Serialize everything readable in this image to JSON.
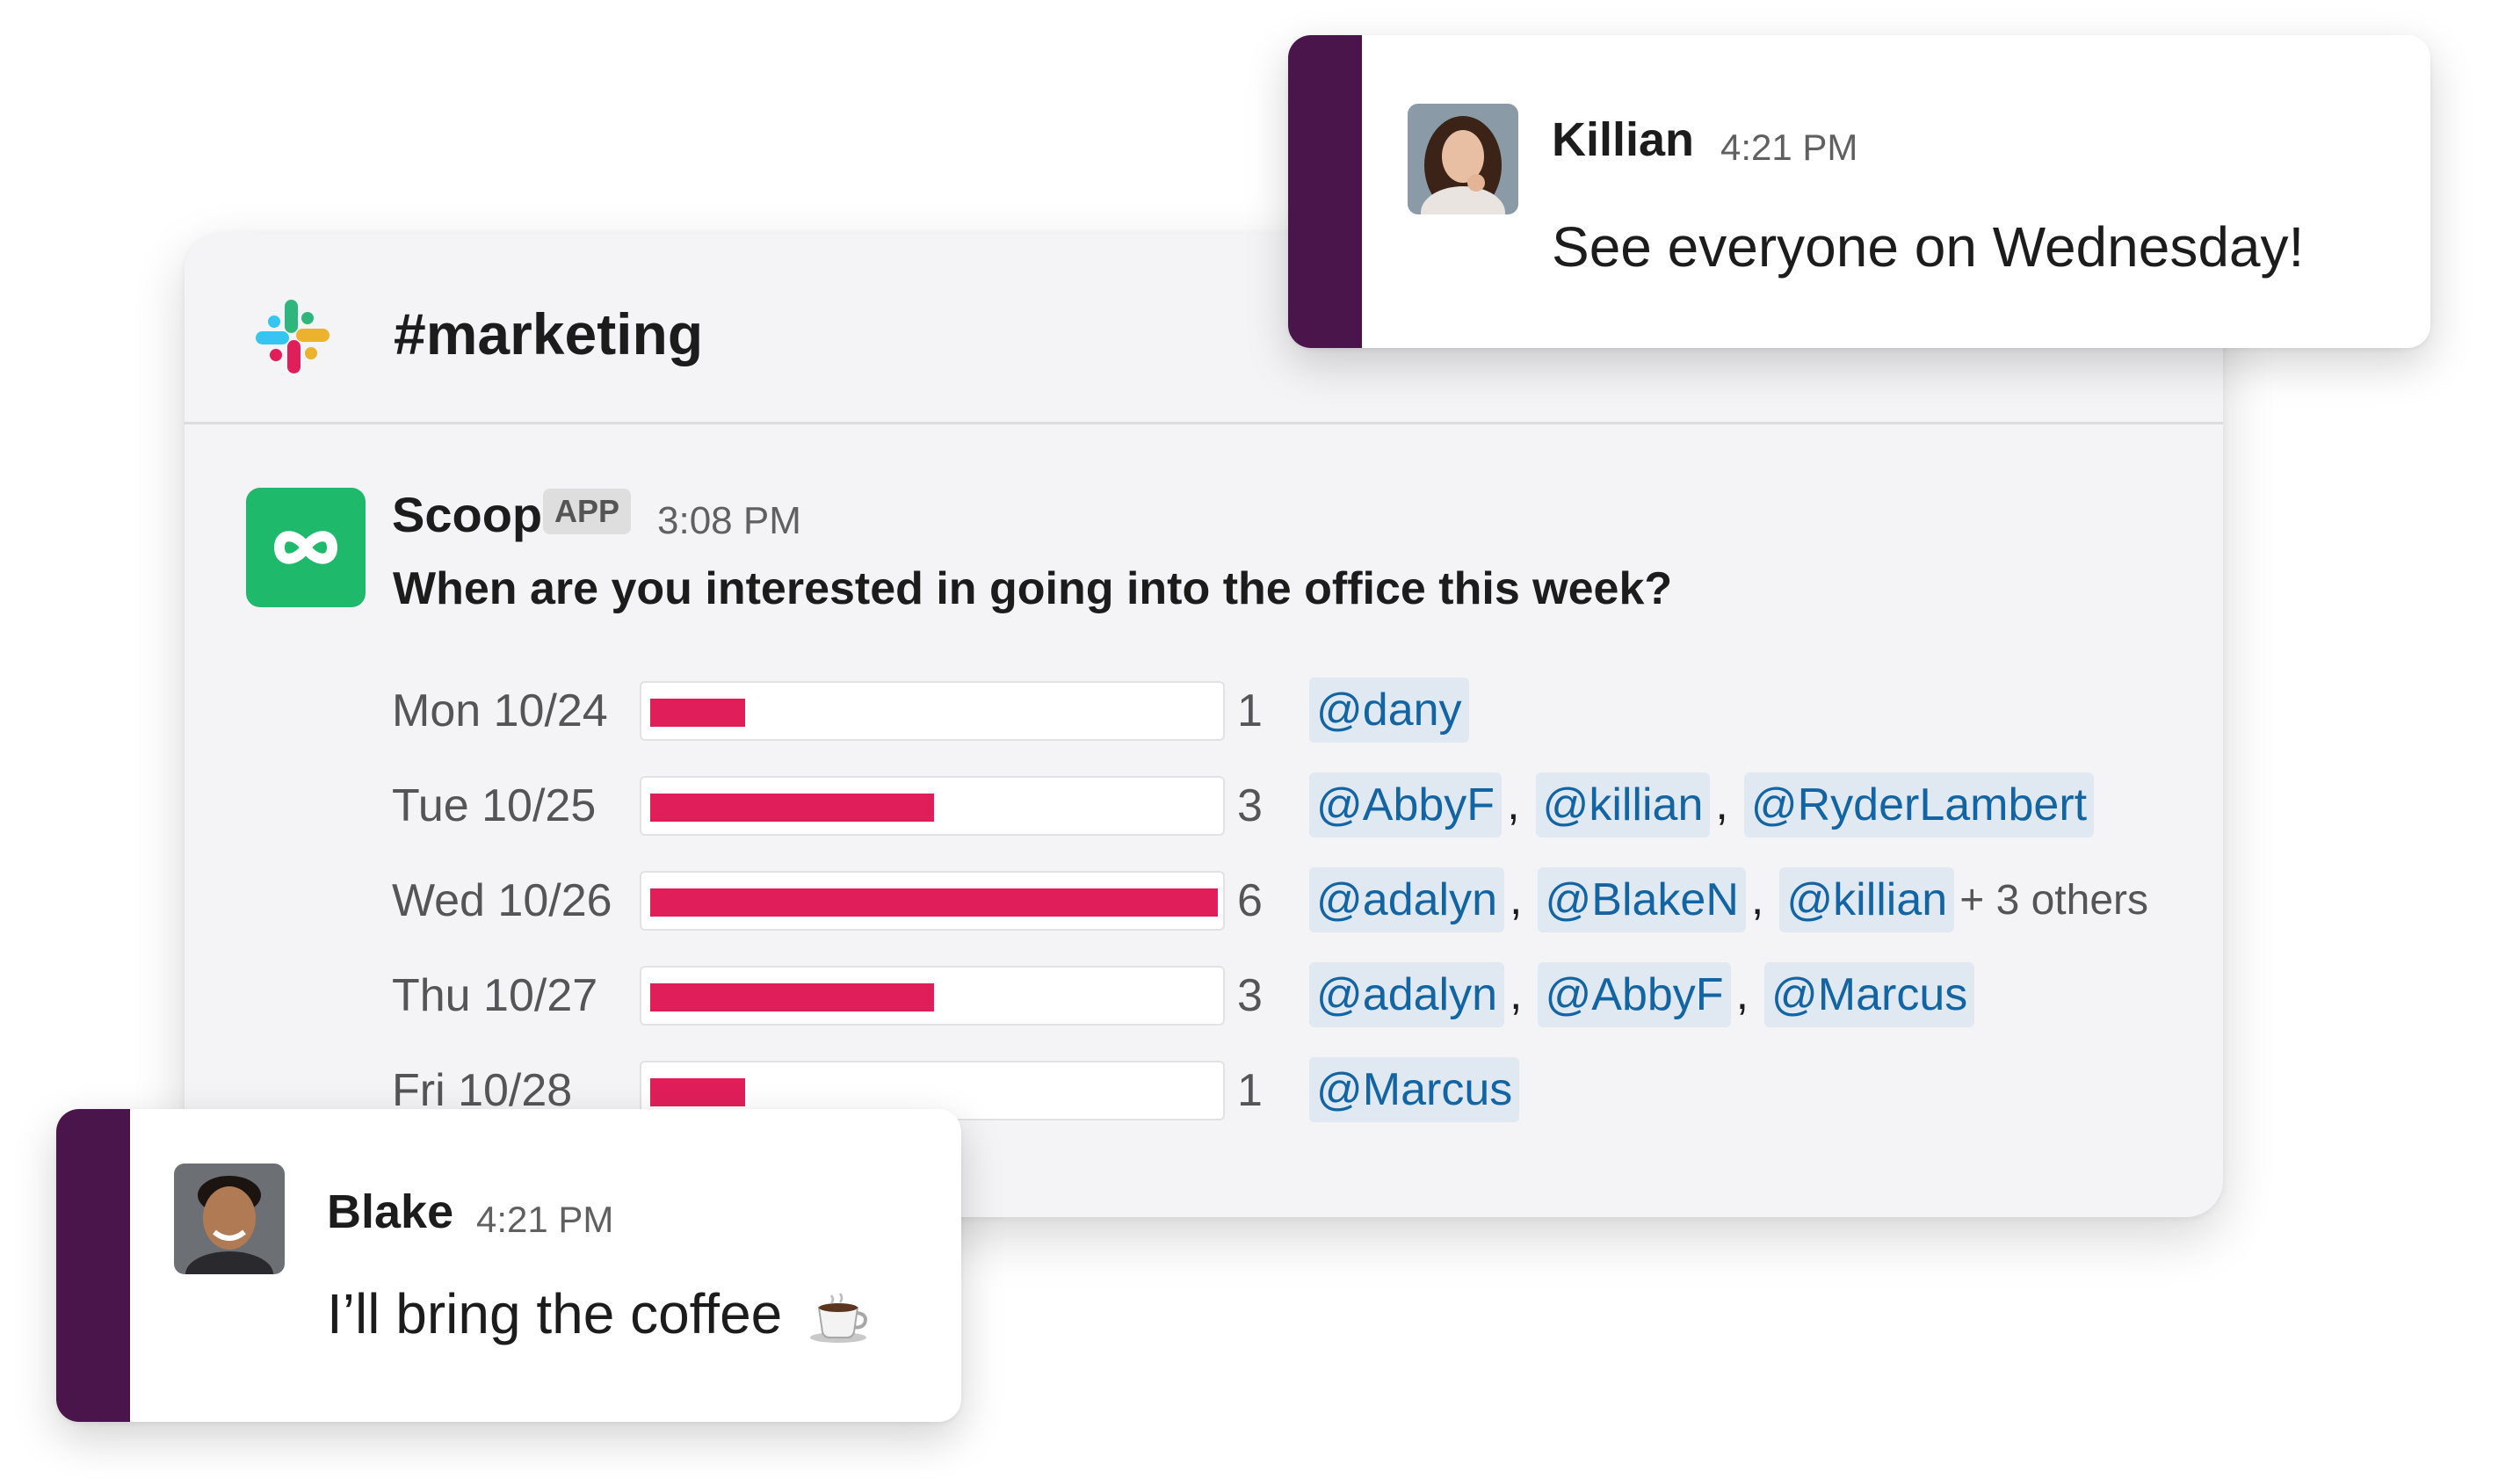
{
  "channel": {
    "name": "#marketing",
    "colors": {
      "slack_red": "#e01e5a",
      "slack_blue": "#36c5f0",
      "slack_green": "#2eb67d",
      "slack_yellow": "#ecb22e"
    }
  },
  "poll_message": {
    "app_name": "Scoop",
    "badge": "APP",
    "time": "3:08 PM",
    "question": "When are you interested in going into the office this week?",
    "icon": "scoop-infinity-icon",
    "bar_color": "#e01e5a",
    "max_votes": 6,
    "rows": [
      {
        "label": "Mon 10/24",
        "count": "1",
        "votes": 1,
        "mentions": [
          "@dany"
        ],
        "others": ""
      },
      {
        "label": "Tue 10/25",
        "count": "3",
        "votes": 3,
        "mentions": [
          "@AbbyF",
          "@killian",
          "@RyderLambert"
        ],
        "others": ""
      },
      {
        "label": "Wed 10/26",
        "count": "6",
        "votes": 6,
        "mentions": [
          "@adalyn",
          "@BlakeN",
          "@killian"
        ],
        "others": "+ 3 others"
      },
      {
        "label": "Thu 10/27",
        "count": "3",
        "votes": 3,
        "mentions": [
          "@adalyn",
          "@AbbyF",
          "@Marcus"
        ],
        "others": ""
      },
      {
        "label": "Fri 10/28",
        "count": "1",
        "votes": 1,
        "mentions": [
          "@Marcus"
        ],
        "others": ""
      }
    ]
  },
  "killian_message": {
    "name": "Killian",
    "time": "4:21 PM",
    "text": "See everyone on Wednesday!",
    "accent": "#4a154b"
  },
  "blake_message": {
    "name": "Blake",
    "time": "4:21 PM",
    "text": "I’ll bring the coffee",
    "emoji": "coffee-cup-icon",
    "accent": "#4a154b"
  }
}
